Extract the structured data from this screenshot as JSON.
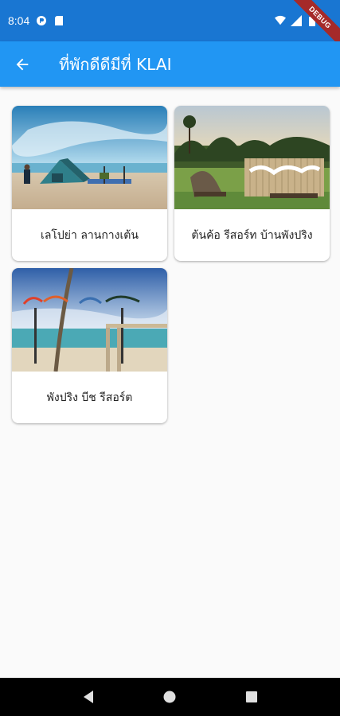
{
  "status_bar": {
    "time": "8:04",
    "icons": [
      "cast-icon",
      "sd-card-icon",
      "wifi-icon",
      "signal-icon",
      "battery-icon"
    ]
  },
  "debug_banner": "DEBUG",
  "app_bar": {
    "back_icon": "arrow-back-icon",
    "title": "ที่พักดีดีมีที่ KLAI"
  },
  "places": [
    {
      "name": "เลโปย่า ลานกางเต้น",
      "image": "beach-campsite-tent-photo"
    },
    {
      "name": "ต้นค้อ รีสอร์ท บ้านพังปริง",
      "image": "resort-sign-bamboo-fence-photo"
    },
    {
      "name": "พังปริง บีช รีสอร์ต",
      "image": "beach-resort-sign-photo"
    }
  ],
  "nav_bar": {
    "buttons": [
      "back-triangle-icon",
      "home-circle-icon",
      "recents-square-icon"
    ]
  },
  "colors": {
    "status_bar": "#1976d2",
    "app_bar": "#2196f3",
    "background": "#fafafa",
    "nav_bar": "#000000"
  }
}
